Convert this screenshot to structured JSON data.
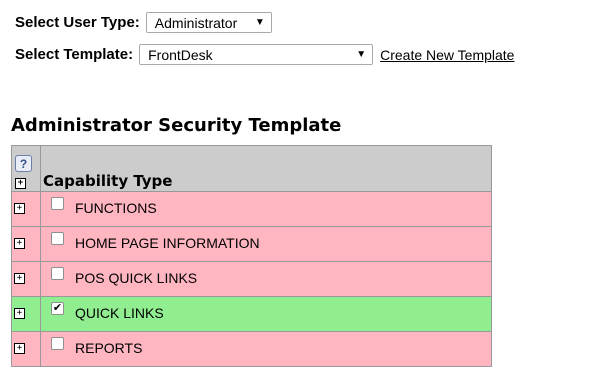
{
  "user_type": {
    "label": "Select User Type:",
    "value": "Administrator"
  },
  "template": {
    "label": "Select Template:",
    "value": "FrontDesk",
    "create_link": "Create New Template"
  },
  "section_title": "Administrator Security Template",
  "table": {
    "help_icon": "?",
    "expand_icon": "+",
    "header": "Capability Type",
    "rows": [
      {
        "label": "FUNCTIONS",
        "checked": false,
        "color": "#ffb6c1"
      },
      {
        "label": "HOME PAGE INFORMATION",
        "checked": false,
        "color": "#ffb6c1"
      },
      {
        "label": "POS QUICK LINKS",
        "checked": false,
        "color": "#ffb6c1"
      },
      {
        "label": "QUICK LINKS",
        "checked": true,
        "color": "#90ee90"
      },
      {
        "label": "REPORTS",
        "checked": false,
        "color": "#ffb6c1"
      }
    ]
  },
  "checkmark_glyph": "✔"
}
